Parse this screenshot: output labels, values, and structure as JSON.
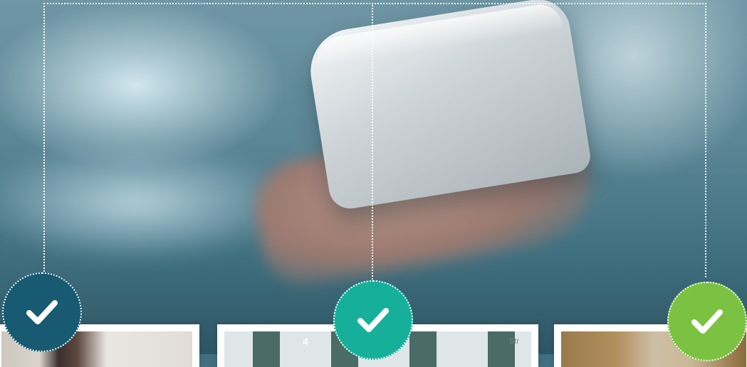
{
  "hero": {
    "image_subject": "hand-holding-smartphone"
  },
  "badges": [
    {
      "icon": "checkmark-icon",
      "color": "#175a72"
    },
    {
      "icon": "checkmark-icon",
      "color": "#16b09a"
    },
    {
      "icon": "checkmark-icon",
      "color": "#7cc242"
    }
  ],
  "cards": [
    {
      "image_subject": "woman-portrait"
    },
    {
      "image_subject": "calculator-keys",
      "visible_key_text": [
        "4",
        "Str"
      ]
    },
    {
      "image_subject": "man-portrait"
    }
  ]
}
